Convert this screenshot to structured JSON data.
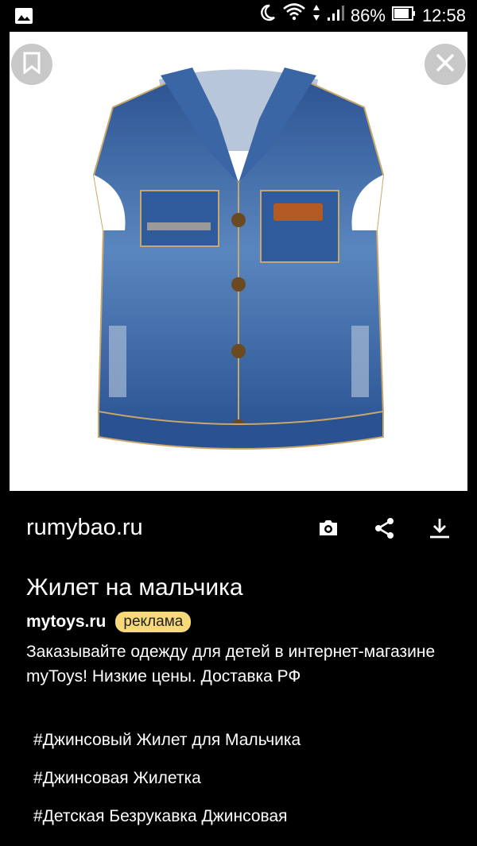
{
  "status_bar": {
    "battery": "86%",
    "time": "12:58",
    "icons": [
      "gallery-icon",
      "moon-icon",
      "wifi-icon",
      "signal-icon",
      "battery-icon"
    ]
  },
  "image": {
    "subject": "denim vest"
  },
  "toolbar": {
    "source": "rumybao.ru",
    "icons": [
      "lens-icon",
      "share-icon",
      "download-icon"
    ]
  },
  "ad": {
    "title": "Жилет на мальчика",
    "domain": "mytoys.ru",
    "badge": "реклама",
    "description": "Заказывайте одежду для детей в интернет-магазине myToys! Низкие цены. Доставка РФ"
  },
  "tags": [
    "#Джинсовый Жилет для Мальчика",
    "#Джинсовая Жилетка",
    "#Детская Безрукавка Джинсовая"
  ],
  "colors": {
    "background": "#000000",
    "badge": "#f7d97a",
    "denim": "#2f5b9c"
  }
}
